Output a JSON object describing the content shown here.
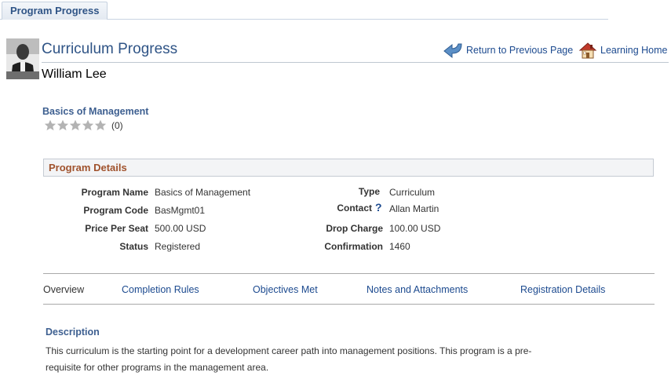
{
  "tab": {
    "label": "Program Progress"
  },
  "header": {
    "title": "Curriculum Progress",
    "person_name": "William Lee",
    "return_label": "Return to Previous Page",
    "home_label": "Learning Home"
  },
  "course": {
    "title": "Basics of Management",
    "rating_value": 0,
    "rating_max": 5,
    "rating_count": "(0)"
  },
  "details": {
    "section_title": "Program Details",
    "left": [
      {
        "label": "Program Name",
        "value": "Basics of Management",
        "link": true
      },
      {
        "label": "Program Code",
        "value": "BasMgmt01",
        "link": false
      },
      {
        "label": "Price Per Seat",
        "value": "500.00 USD",
        "link": false
      },
      {
        "label": "Status",
        "value": "Registered",
        "link": false
      }
    ],
    "right": [
      {
        "label": "Type",
        "value": "Curriculum"
      },
      {
        "label": "Contact",
        "value": "Allan Martin"
      },
      {
        "label": "Drop Charge",
        "value": "100.00 USD"
      },
      {
        "label": "Confirmation",
        "value": "1460"
      }
    ],
    "help_glyph": "?"
  },
  "subtabs": [
    {
      "label": "Overview",
      "active": true
    },
    {
      "label": "Completion Rules",
      "active": false
    },
    {
      "label": "Objectives Met",
      "active": false
    },
    {
      "label": "Notes and Attachments",
      "active": false
    },
    {
      "label": "Registration Details",
      "active": false
    }
  ],
  "description": {
    "title": "Description",
    "text": "This curriculum is the starting point for a development career path into management positions. This program is a pre-requisite for other programs in the management area."
  },
  "icons": {
    "avatar": "person-photo",
    "return": "return-arrow-icon",
    "home": "house-icon",
    "star": "star-icon",
    "help": "help-icon"
  },
  "colors": {
    "link": "#1c4a8f",
    "title": "#2f5486",
    "section_title": "#a0522d",
    "star_empty": "#b3b3b3"
  }
}
